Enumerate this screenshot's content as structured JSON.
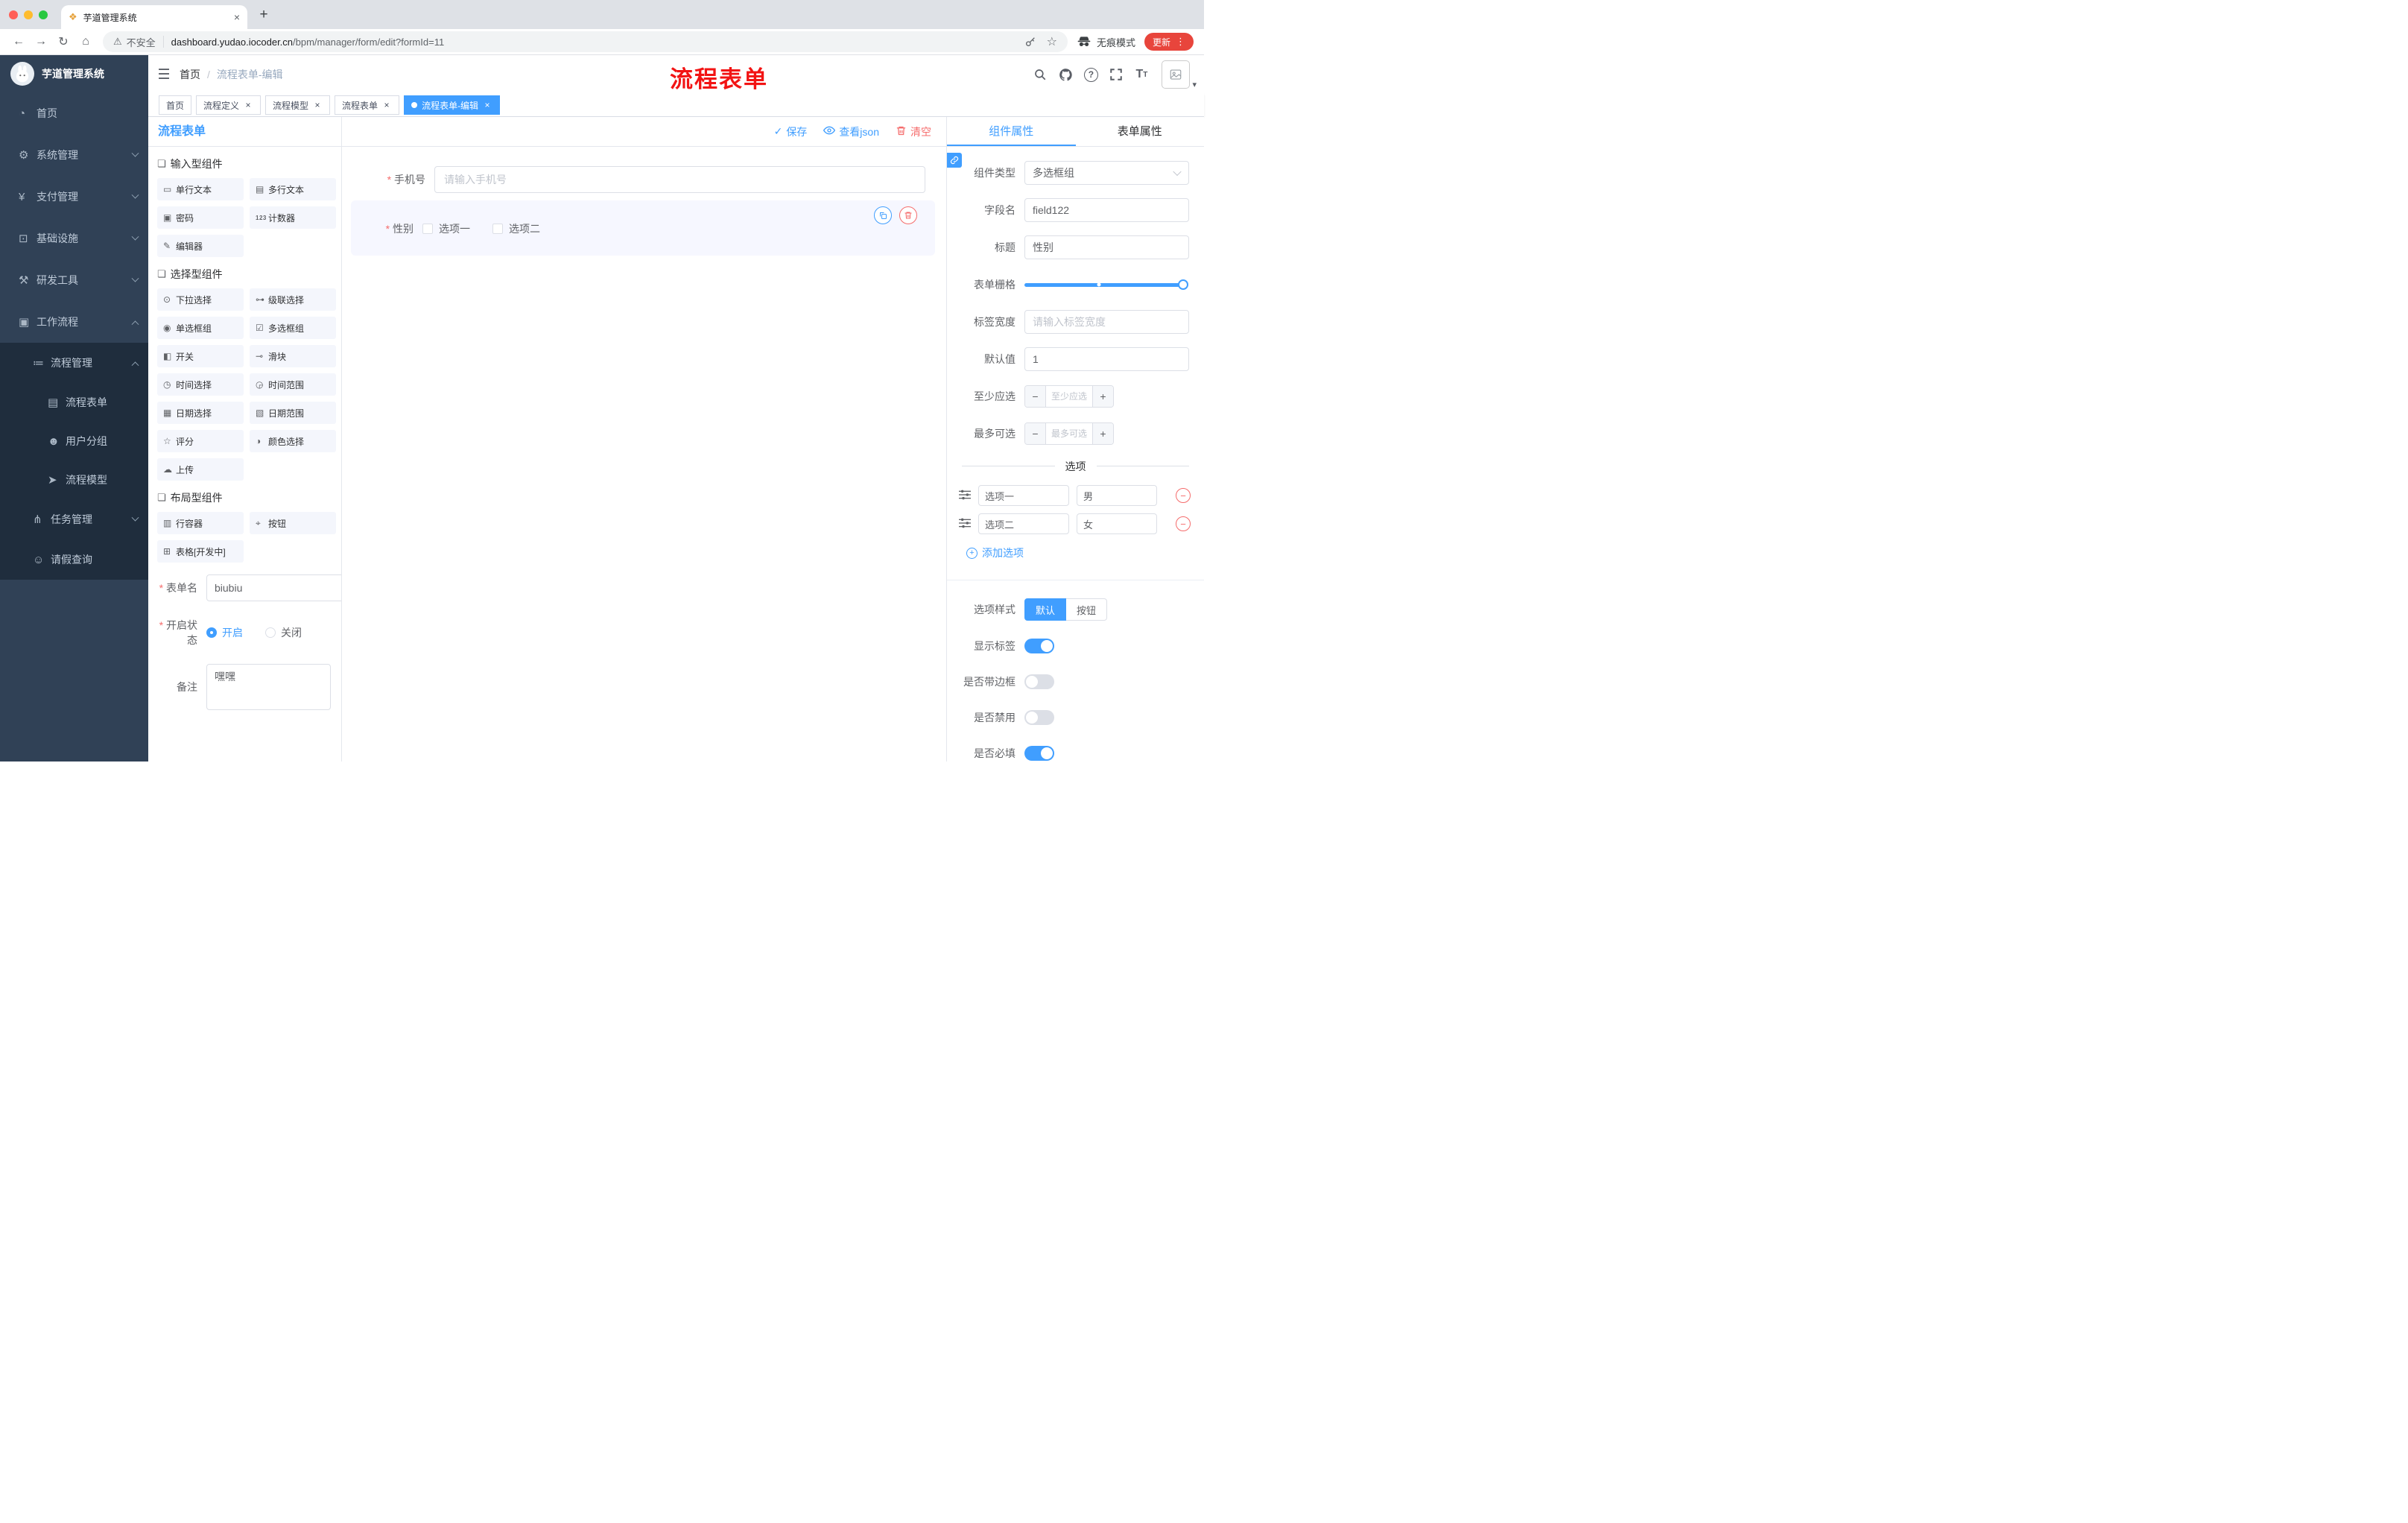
{
  "icons": {
    "close": "×",
    "plus": "+",
    "minus": "−",
    "check": "✓",
    "caret-down": "▾",
    "back": "←",
    "forward": "→",
    "reload": "↻",
    "home": "⌂",
    "warning": "⚠",
    "star": "☆",
    "kebab": "⋮",
    "hamburger": "☰",
    "slash": "/",
    "question": "?",
    "textsize-big": "T",
    "textsize-small": "T",
    "favicon": "❖",
    "newtab": "+",
    "section": "❏",
    "text-input": "▭",
    "textarea": "▤",
    "password": "▣",
    "counter": "123",
    "editor": "✎",
    "select": "⊙",
    "cascader": "⊶",
    "radio": "◉",
    "checkbox": "☑",
    "switch": "◧",
    "slider": "⊸",
    "time": "◷",
    "time-range": "◶",
    "date": "▦",
    "date-range": "▧",
    "rate": "☆",
    "color": "◑",
    "upload": "☁",
    "row": "▥",
    "button": "⌖",
    "table": "⊞",
    "dashboard": "◔",
    "gear": "⚙",
    "yen": "¥",
    "monitor": "⊡",
    "tools": "⚒",
    "briefcase": "▣",
    "list": "≔",
    "document": "▤",
    "users": "☻",
    "send": "➤",
    "tree": "⋔",
    "user": "☺"
  },
  "colors": {
    "primary": "#409eff",
    "danger": "#f56c6c",
    "sidebar_bg": "#304156",
    "sidebar_sub_bg": "#1f2d3d",
    "update_pill": "#e8453c",
    "annotation_red": "#f21414"
  },
  "browser": {
    "tab_title": "芋道管理系统",
    "security_label": "不安全",
    "url_host": "dashboard.yudao.iocoder.cn",
    "url_path": "/bpm/manager/form/edit?formId=11",
    "incognito_label": "无痕模式",
    "update_label": "更新"
  },
  "sidebar": {
    "logo_title": "芋道管理系统",
    "items": [
      {
        "label": "首页",
        "icon": "dashboard",
        "level": 1
      },
      {
        "label": "系统管理",
        "icon": "gear",
        "level": 1,
        "expanded": false
      },
      {
        "label": "支付管理",
        "icon": "yen",
        "level": 1,
        "expanded": false
      },
      {
        "label": "基础设施",
        "icon": "monitor",
        "level": 1,
        "expanded": false
      },
      {
        "label": "研发工具",
        "icon": "tools",
        "level": 1,
        "expanded": false
      },
      {
        "label": "工作流程",
        "icon": "briefcase",
        "level": 1,
        "expanded": true
      },
      {
        "label": "流程管理",
        "icon": "list",
        "level": 2,
        "expanded": true
      },
      {
        "label": "流程表单",
        "icon": "document",
        "level": 3
      },
      {
        "label": "用户分组",
        "icon": "users",
        "level": 3
      },
      {
        "label": "流程模型",
        "icon": "send",
        "level": 3
      },
      {
        "label": "任务管理",
        "icon": "tree",
        "level": 2,
        "expanded": false
      },
      {
        "label": "请假查询",
        "icon": "user",
        "level": 2
      }
    ]
  },
  "navbar": {
    "breadcrumb": [
      "首页",
      "流程表单-编辑"
    ],
    "annotation": "流程表单"
  },
  "tags": [
    {
      "label": "首页",
      "closable": false,
      "active": false
    },
    {
      "label": "流程定义",
      "closable": true,
      "active": false
    },
    {
      "label": "流程模型",
      "closable": true,
      "active": false
    },
    {
      "label": "流程表单",
      "closable": true,
      "active": false
    },
    {
      "label": "流程表单-编辑",
      "closable": true,
      "active": true
    }
  ],
  "palette": {
    "title": "流程表单",
    "sections": [
      {
        "title": "输入型组件",
        "items": [
          {
            "label": "单行文本",
            "icon": "text-input"
          },
          {
            "label": "多行文本",
            "icon": "textarea"
          },
          {
            "label": "密码",
            "icon": "password"
          },
          {
            "label": "计数器",
            "icon": "counter"
          },
          {
            "label": "编辑器",
            "icon": "editor"
          }
        ]
      },
      {
        "title": "选择型组件",
        "items": [
          {
            "label": "下拉选择",
            "icon": "select"
          },
          {
            "label": "级联选择",
            "icon": "cascader"
          },
          {
            "label": "单选框组",
            "icon": "radio"
          },
          {
            "label": "多选框组",
            "icon": "checkbox"
          },
          {
            "label": "开关",
            "icon": "switch"
          },
          {
            "label": "滑块",
            "icon": "slider"
          },
          {
            "label": "时间选择",
            "icon": "time"
          },
          {
            "label": "时间范围",
            "icon": "time-range"
          },
          {
            "label": "日期选择",
            "icon": "date"
          },
          {
            "label": "日期范围",
            "icon": "date-range"
          },
          {
            "label": "评分",
            "icon": "rate"
          },
          {
            "label": "颜色选择",
            "icon": "color"
          },
          {
            "label": "上传",
            "icon": "upload"
          }
        ]
      },
      {
        "title": "布局型组件",
        "items": [
          {
            "label": "行容器",
            "icon": "row"
          },
          {
            "label": "按钮",
            "icon": "button"
          },
          {
            "label": "表格[开发中]",
            "icon": "table"
          }
        ]
      }
    ],
    "form": {
      "name_label": "表单名",
      "name_value": "biubiu",
      "status_label": "开启状态",
      "status_on": "开启",
      "status_off": "关闭",
      "status_selected": "开启",
      "remark_label": "备注",
      "remark_value": "嘿嘿"
    }
  },
  "canvas": {
    "actions": [
      {
        "label": "保存"
      },
      {
        "label": "查看json"
      },
      {
        "label": "清空"
      }
    ],
    "fields": [
      {
        "label": "手机号",
        "required": true,
        "type": "input",
        "placeholder": "请输入手机号"
      },
      {
        "label": "性别",
        "required": true,
        "type": "checkbox-group",
        "options": [
          "选项一",
          "选项二"
        ],
        "selected": true
      }
    ]
  },
  "inspector": {
    "tabs": [
      "组件属性",
      "表单属性"
    ],
    "active_tab": "组件属性",
    "fields": {
      "component_type": {
        "label": "组件类型",
        "value": "多选框组"
      },
      "field_name": {
        "label": "字段名",
        "value": "field122"
      },
      "title": {
        "label": "标题",
        "value": "性别"
      },
      "grid": {
        "label": "表单栅格",
        "value_max": true
      },
      "label_width": {
        "label": "标签宽度",
        "placeholder": "请输入标签宽度"
      },
      "default_value": {
        "label": "默认值",
        "value": "1"
      },
      "min_select": {
        "label": "至少应选",
        "placeholder": "至少应选"
      },
      "max_select": {
        "label": "最多可选",
        "placeholder": "最多可选"
      }
    },
    "options": {
      "divider_label": "选项",
      "rows": [
        {
          "label": "选项一",
          "value": "男"
        },
        {
          "label": "选项二",
          "value": "女"
        }
      ],
      "add_label": "添加选项"
    },
    "style": {
      "label": "选项样式",
      "options": [
        "默认",
        "按钮"
      ],
      "selected": "默认"
    },
    "switches": [
      {
        "label": "显示标签",
        "on": true
      },
      {
        "label": "是否带边框",
        "on": false
      },
      {
        "label": "是否禁用",
        "on": false
      },
      {
        "label": "是否必填",
        "on": true
      }
    ]
  }
}
